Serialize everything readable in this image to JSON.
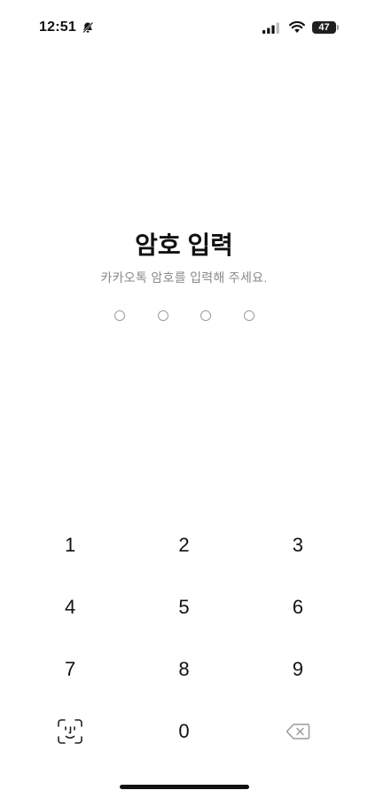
{
  "status_bar": {
    "time": "12:51",
    "battery_level": "47",
    "icons": [
      "bell-icon",
      "signal-icon",
      "wifi-icon",
      "battery-icon"
    ]
  },
  "header": {
    "title": "암호 입력",
    "subtitle": "카카오톡 암호를 입력해 주세요."
  },
  "passcode": {
    "length": 4,
    "filled": 0
  },
  "keypad": {
    "rows": [
      [
        "1",
        "2",
        "3"
      ],
      [
        "4",
        "5",
        "6"
      ],
      [
        "7",
        "8",
        "9"
      ],
      [
        "face-id-icon",
        "0",
        "backspace-icon"
      ]
    ]
  },
  "colors": {
    "background": "#ffffff",
    "text": "#111111",
    "subtitle": "#8a8a8a",
    "dot_border": "#9c9c9c"
  }
}
